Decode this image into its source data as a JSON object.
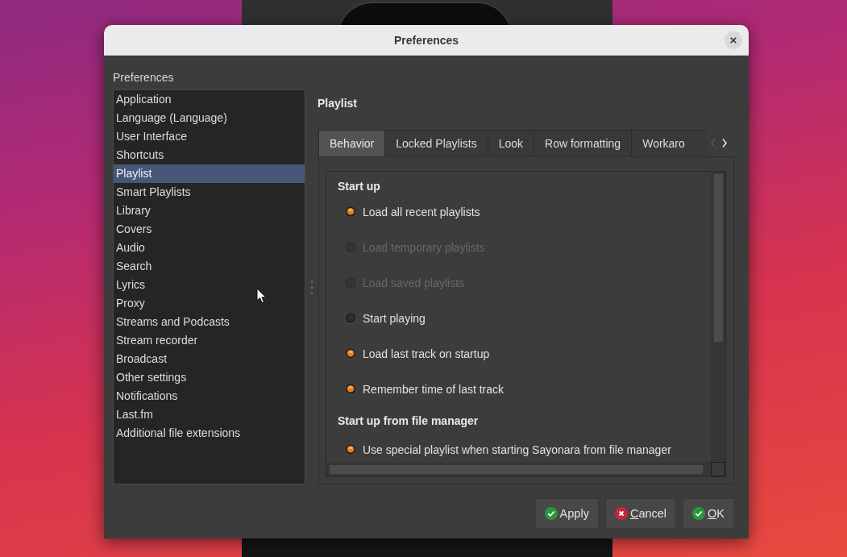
{
  "window": {
    "title": "Preferences"
  },
  "sidebar": {
    "heading": "Preferences",
    "items": [
      {
        "label": "Application",
        "selected": false
      },
      {
        "label": "Language (Language)",
        "selected": false
      },
      {
        "label": "User Interface",
        "selected": false
      },
      {
        "label": "Shortcuts",
        "selected": false
      },
      {
        "label": "Playlist",
        "selected": true
      },
      {
        "label": "Smart Playlists",
        "selected": false
      },
      {
        "label": "Library",
        "selected": false
      },
      {
        "label": "Covers",
        "selected": false
      },
      {
        "label": "Audio",
        "selected": false
      },
      {
        "label": "Search",
        "selected": false
      },
      {
        "label": "Lyrics",
        "selected": false
      },
      {
        "label": "Proxy",
        "selected": false
      },
      {
        "label": "Streams and Podcasts",
        "selected": false
      },
      {
        "label": "Stream recorder",
        "selected": false
      },
      {
        "label": "Broadcast",
        "selected": false
      },
      {
        "label": "Other settings",
        "selected": false
      },
      {
        "label": "Notifications",
        "selected": false
      },
      {
        "label": "Last.fm",
        "selected": false
      },
      {
        "label": "Additional file extensions",
        "selected": false
      }
    ]
  },
  "page": {
    "title": "Playlist",
    "tabs": [
      {
        "label": "Behavior",
        "selected": true
      },
      {
        "label": "Locked Playlists",
        "selected": false
      },
      {
        "label": "Look",
        "selected": false
      },
      {
        "label": "Row formatting",
        "selected": false
      },
      {
        "label": "Workaro",
        "selected": false
      }
    ],
    "tab_scroller": {
      "back_enabled": false,
      "forward_enabled": true
    },
    "sections": [
      {
        "title": "Start up",
        "options": [
          {
            "label": "Load all recent playlists",
            "checked": true,
            "disabled": false
          },
          {
            "label": "Load temporary playlists",
            "checked": false,
            "disabled": true
          },
          {
            "label": "Load saved playlists",
            "checked": false,
            "disabled": true
          },
          {
            "label": "Start playing",
            "checked": false,
            "disabled": false
          },
          {
            "label": "Load last track on startup",
            "checked": true,
            "disabled": false
          },
          {
            "label": "Remember time of last track",
            "checked": true,
            "disabled": false
          }
        ]
      },
      {
        "title": "Start up from file manager",
        "options": [
          {
            "label": "Use special playlist when starting Sayonara from file manager",
            "checked": true,
            "disabled": false
          }
        ]
      }
    ]
  },
  "buttons": [
    {
      "kind": "apply",
      "label": "Apply",
      "mnemonic": false
    },
    {
      "kind": "cancel",
      "label": "Cancel",
      "mnemonic": true
    },
    {
      "kind": "ok",
      "label": "OK",
      "mnemonic": true
    }
  ]
}
